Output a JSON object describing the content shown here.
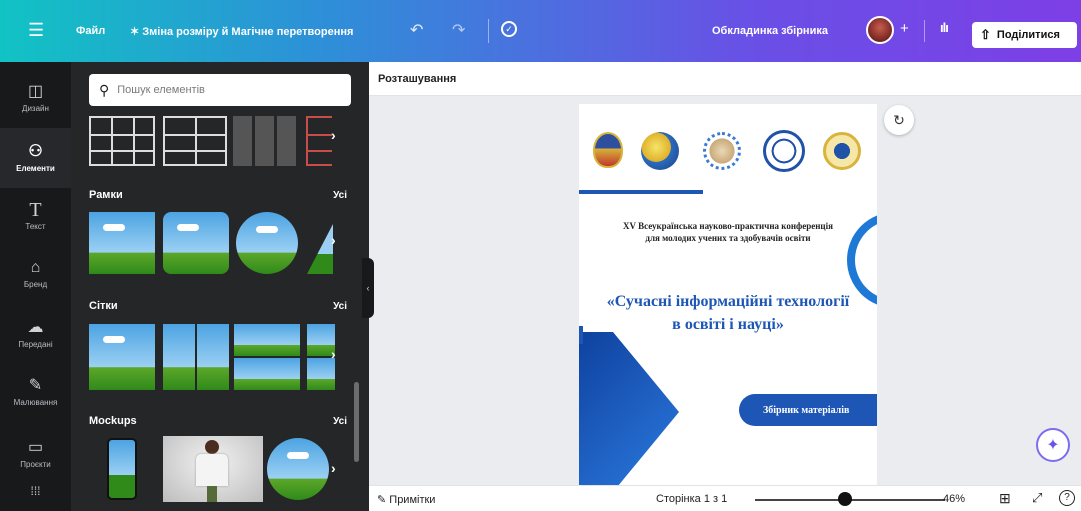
{
  "topbar": {
    "file_label": "Файл",
    "resize_label": "Зміна розміру й Магічне перетворення",
    "doc_title": "Обкладинка збірника",
    "share_label": "Поділитися"
  },
  "rail": [
    {
      "label": "Дизайн",
      "icon": "layout-icon"
    },
    {
      "label": "Елементи",
      "icon": "shapes-icon"
    },
    {
      "label": "Текст",
      "icon": "text-icon"
    },
    {
      "label": "Бренд",
      "icon": "brand-icon"
    },
    {
      "label": "Передані",
      "icon": "upload-icon"
    },
    {
      "label": "Малювання",
      "icon": "draw-icon"
    },
    {
      "label": "Проєкти",
      "icon": "folder-icon"
    }
  ],
  "panel": {
    "search_placeholder": "Пошук елементів",
    "sections": [
      {
        "title": "Рамки",
        "all": "Усі"
      },
      {
        "title": "Сітки",
        "all": "Усі"
      },
      {
        "title": "Mockups",
        "all": "Усі"
      }
    ]
  },
  "canvas": {
    "context_label": "Розташування",
    "conference": "XV Всеукраїнська науково-практична конференція для молодих учених та здобувачів освіти",
    "title": "«Сучасні інформаційні технології в освіті і науці»",
    "badge": "Збірник матеріалів"
  },
  "bottom": {
    "notes_label": "Примітки",
    "page_label": "Сторінка 1 з 1",
    "zoom_label": "46%",
    "zoom_value": 0.46
  },
  "colors": {
    "accent_blue": "#1e56b6",
    "panel_bg": "#252627",
    "rail_bg": "#18191b"
  }
}
